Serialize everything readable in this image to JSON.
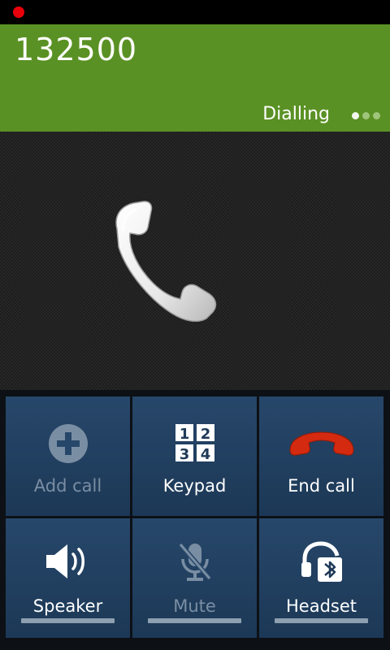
{
  "call": {
    "number": "132500",
    "state": "Dialling",
    "page_dots": 3,
    "active_dot": 0
  },
  "controls": {
    "add_call": {
      "label": "Add call",
      "enabled": false,
      "icon": "plus-circle-icon"
    },
    "keypad": {
      "label": "Keypad",
      "enabled": true,
      "icon": "keypad-icon",
      "digits": [
        "1",
        "2",
        "3",
        "4"
      ]
    },
    "end_call": {
      "label": "End call",
      "enabled": true,
      "icon": "end-call-handset-icon"
    },
    "speaker": {
      "label": "Speaker",
      "enabled": true,
      "icon": "speaker-icon"
    },
    "mute": {
      "label": "Mute",
      "enabled": false,
      "icon": "mic-muted-icon"
    },
    "headset": {
      "label": "Headset",
      "enabled": true,
      "icon": "bluetooth-headset-icon"
    }
  },
  "colors": {
    "header_green": "#5a9124",
    "end_call_red": "#d42a10",
    "button_blue": "#27476a",
    "recording_red": "#e8000b"
  }
}
